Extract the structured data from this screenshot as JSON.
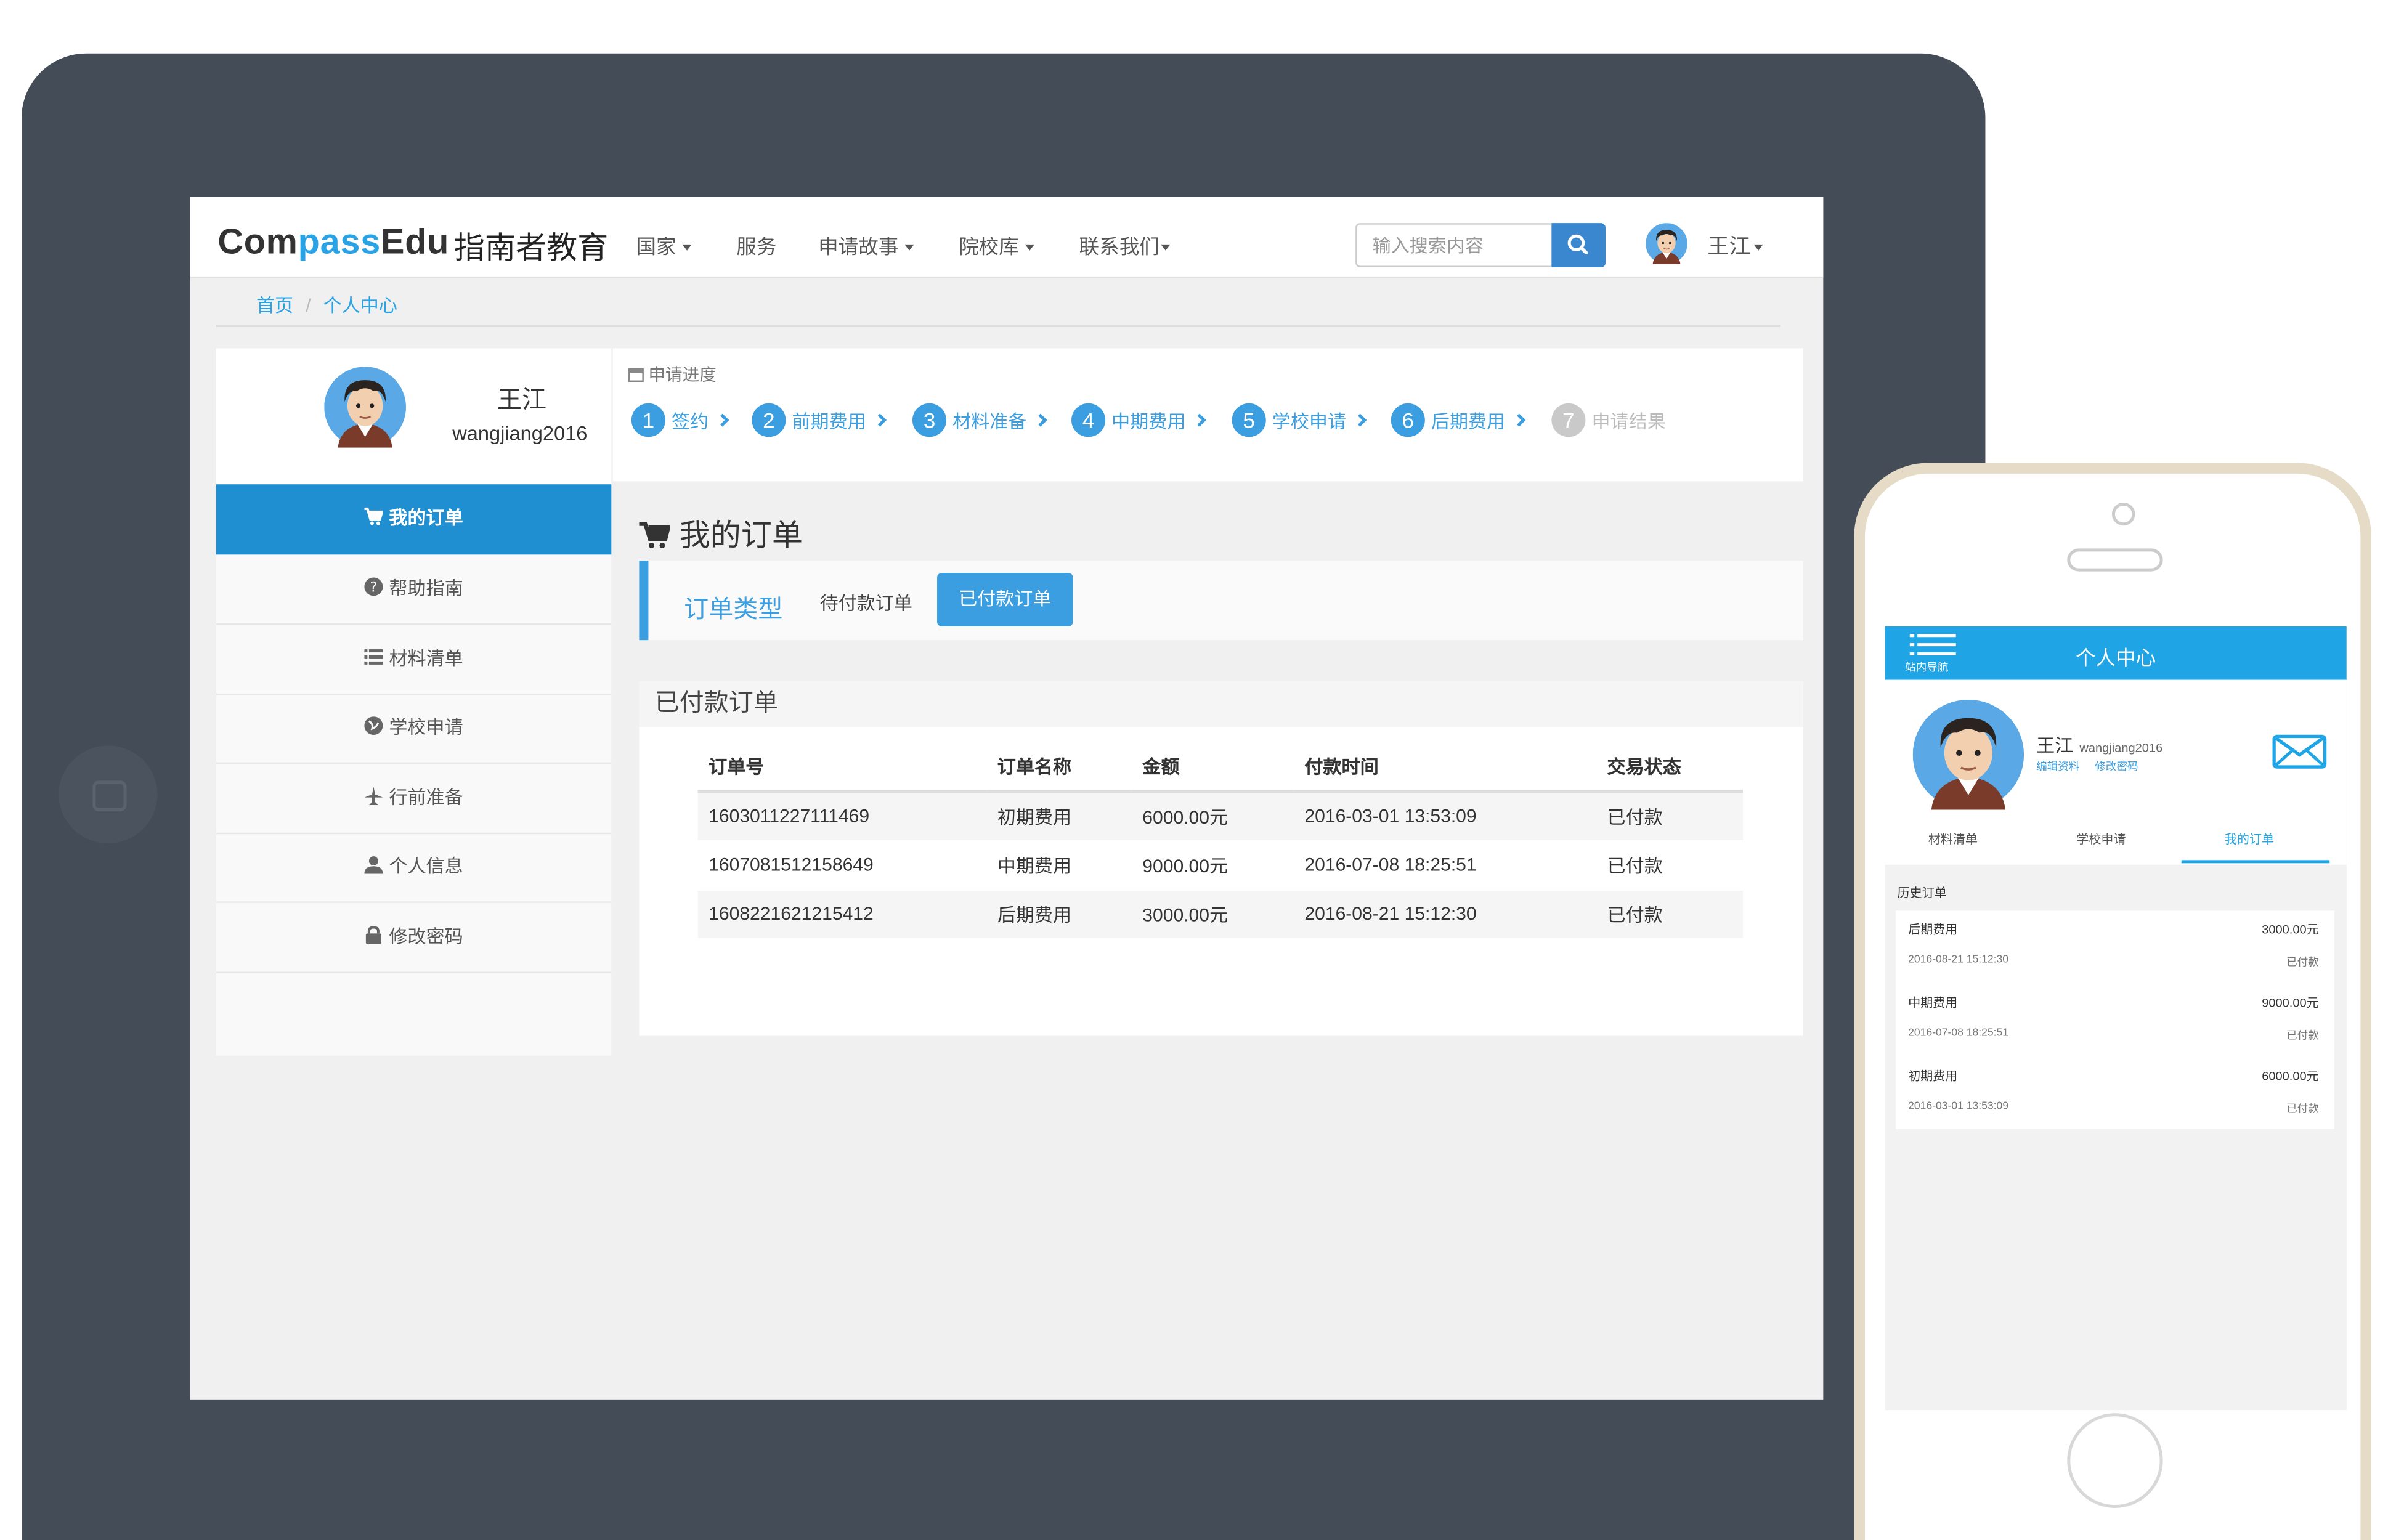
{
  "nav": {
    "logo_a": "Com",
    "logo_b": "pass",
    "logo_c": "Edu",
    "logo_cn": "指南者教育",
    "items": [
      "国家",
      "服务",
      "申请故事",
      "院校库",
      "联系我们"
    ],
    "search_placeholder": "输入搜索内容",
    "user": "王江"
  },
  "breadcrumb": [
    "首页",
    "个人中心"
  ],
  "profile": {
    "name": "王江",
    "username": "wangjiang2016"
  },
  "sidebar": {
    "items": [
      "我的订单",
      "帮助指南",
      "材料清单",
      "学校申请",
      "行前准备",
      "个人信息",
      "修改密码"
    ],
    "active_index": 0
  },
  "progress": {
    "title": "申请进度",
    "steps": [
      {
        "n": "1",
        "label": "签约"
      },
      {
        "n": "2",
        "label": "前期费用"
      },
      {
        "n": "3",
        "label": "材料准备"
      },
      {
        "n": "4",
        "label": "中期费用"
      },
      {
        "n": "5",
        "label": "学校申请"
      },
      {
        "n": "6",
        "label": "后期费用"
      },
      {
        "n": "7",
        "label": "申请结果"
      }
    ]
  },
  "orders": {
    "title": "我的订单",
    "filter_label": "订单类型",
    "filter_pending": "待付款订单",
    "filter_paid": "已付款订单",
    "panel_title": "已付款订单",
    "columns": [
      "订单号",
      "订单名称",
      "金额",
      "付款时间",
      "交易状态"
    ],
    "rows": [
      [
        "1603011227111469",
        "初期费用",
        "6000.00元",
        "2016-03-01 13:53:09",
        "已付款"
      ],
      [
        "1607081512158649",
        "中期费用",
        "9000.00元",
        "2016-07-08 18:25:51",
        "已付款"
      ],
      [
        "1608221621215412",
        "后期费用",
        "3000.00元",
        "2016-08-21 15:12:30",
        "已付款"
      ]
    ]
  },
  "mobile": {
    "title": "个人中心",
    "nav_label": "站内导航",
    "name": "王江",
    "username": "wangjiang2016",
    "link_edit": "编辑资料",
    "link_pwd": "修改密码",
    "tabs": [
      "材料清单",
      "学校申请",
      "我的订单"
    ],
    "history_title": "历史订单",
    "items": [
      {
        "name": "后期费用",
        "amount": "3000.00元",
        "time": "2016-08-21 15:12:30",
        "status": "已付款"
      },
      {
        "name": "中期费用",
        "amount": "9000.00元",
        "time": "2016-07-08 18:25:51",
        "status": "已付款"
      },
      {
        "name": "初期费用",
        "amount": "6000.00元",
        "time": "2016-03-01 13:53:09",
        "status": "已付款"
      }
    ]
  },
  "colors": {
    "tablet_frame": "#444c58",
    "accent": "#3a9ee0",
    "active_menu": "#1f8fd1",
    "phone_frame": "#e6dbc6",
    "phone_header": "#1fa5e6"
  }
}
